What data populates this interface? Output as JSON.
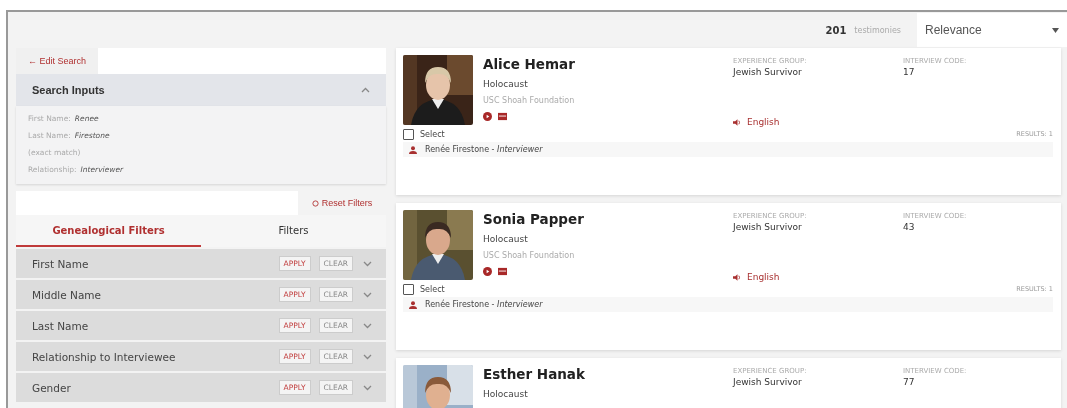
{
  "header": {
    "count": "201",
    "count_label": "testimonies",
    "sort": "Relevance"
  },
  "sidebar": {
    "edit_search": "← Edit Search",
    "search_inputs": {
      "title": "Search Inputs",
      "expanded": true,
      "lines": [
        {
          "label": "First Name:",
          "value": "Renee"
        },
        {
          "label": "Last Name:",
          "value": "Firestone"
        },
        {
          "label": "(exact match)"
        },
        {
          "label": "Relationship:",
          "value": "Interviewer"
        }
      ]
    },
    "reset": "Reset Filters",
    "tabs": [
      {
        "label": "Genealogical Filters",
        "selected": true
      },
      {
        "label": "Filters",
        "selected": false
      }
    ],
    "filters": [
      {
        "label": "First Name",
        "apply": "APPLY",
        "clear": "CLEAR",
        "expanded": false
      },
      {
        "label": "Middle Name",
        "apply": "APPLY",
        "clear": "CLEAR",
        "expanded": false
      },
      {
        "label": "Last Name",
        "apply": "APPLY",
        "clear": "CLEAR",
        "expanded": false
      },
      {
        "label": "Relationship to Interviewee",
        "apply": "APPLY",
        "clear": "CLEAR",
        "expanded": false
      },
      {
        "label": "Gender",
        "apply": "APPLY",
        "clear": "CLEAR",
        "expanded": false
      }
    ]
  },
  "results": [
    {
      "name": "Alice Hemar",
      "category": "Holocaust",
      "org": "USC Shoah Foundation",
      "experience_label": "EXPERIENCE GROUP:",
      "experience": "Jewish Survivor",
      "code_label": "INTERVIEW CODE:",
      "code": "17",
      "language": "English",
      "select_label": "Select",
      "selected": false,
      "results": "RESULTS: 1",
      "interviewer": "Renée Firestone - *Interviewer*"
    },
    {
      "name": "Sonia Papper",
      "category": "Holocaust",
      "org": "USC Shoah Foundation",
      "experience_label": "EXPERIENCE GROUP:",
      "experience": "Jewish Survivor",
      "code_label": "INTERVIEW CODE:",
      "code": "43",
      "language": "English",
      "select_label": "Select",
      "selected": false,
      "results": "RESULTS: 1",
      "interviewer": "Renée Firestone - *Interviewer*"
    },
    {
      "name": "Esther Hanak",
      "category": "Holocaust",
      "experience_label": "EXPERIENCE GROUP:",
      "experience": "Jewish Survivor",
      "code_label": "INTERVIEW CODE:",
      "code": "77"
    }
  ]
}
